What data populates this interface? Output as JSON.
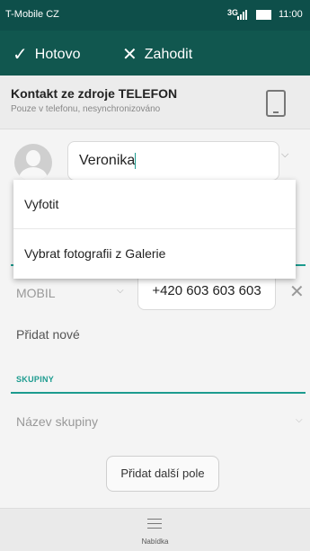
{
  "status_bar": {
    "carrier": "T-Mobile CZ",
    "network": "3G",
    "time": "11:00"
  },
  "action_bar": {
    "done_label": "Hotovo",
    "discard_label": "Zahodit"
  },
  "account": {
    "title": "Kontakt ze zdroje TELEFON",
    "subtitle": "Pouze v telefonu, nesynchronizováno"
  },
  "name_field": {
    "value": "Veronika"
  },
  "photo_menu": {
    "items": [
      "Vyfotit",
      "Vybrat fotografii z Galerie"
    ]
  },
  "phone": {
    "type": "MOBIL",
    "value": "+420 603 603 603"
  },
  "add_new_label": "Přidat nové",
  "groups": {
    "header": "SKUPINY",
    "placeholder": "Název skupiny"
  },
  "add_field_button": "Přidat další pole",
  "bottom_bar": {
    "menu_label": "Nabídka"
  },
  "icons": {
    "done": "check-icon",
    "discard": "close-icon",
    "account": "phone-device-icon",
    "avatar": "avatar-placeholder-icon",
    "remove": "close-icon",
    "menu": "hamburger-menu-icon"
  },
  "colors": {
    "status_bar": "#0e4f4a",
    "action_bar": "#11574f",
    "accent": "#1c9b8f"
  }
}
